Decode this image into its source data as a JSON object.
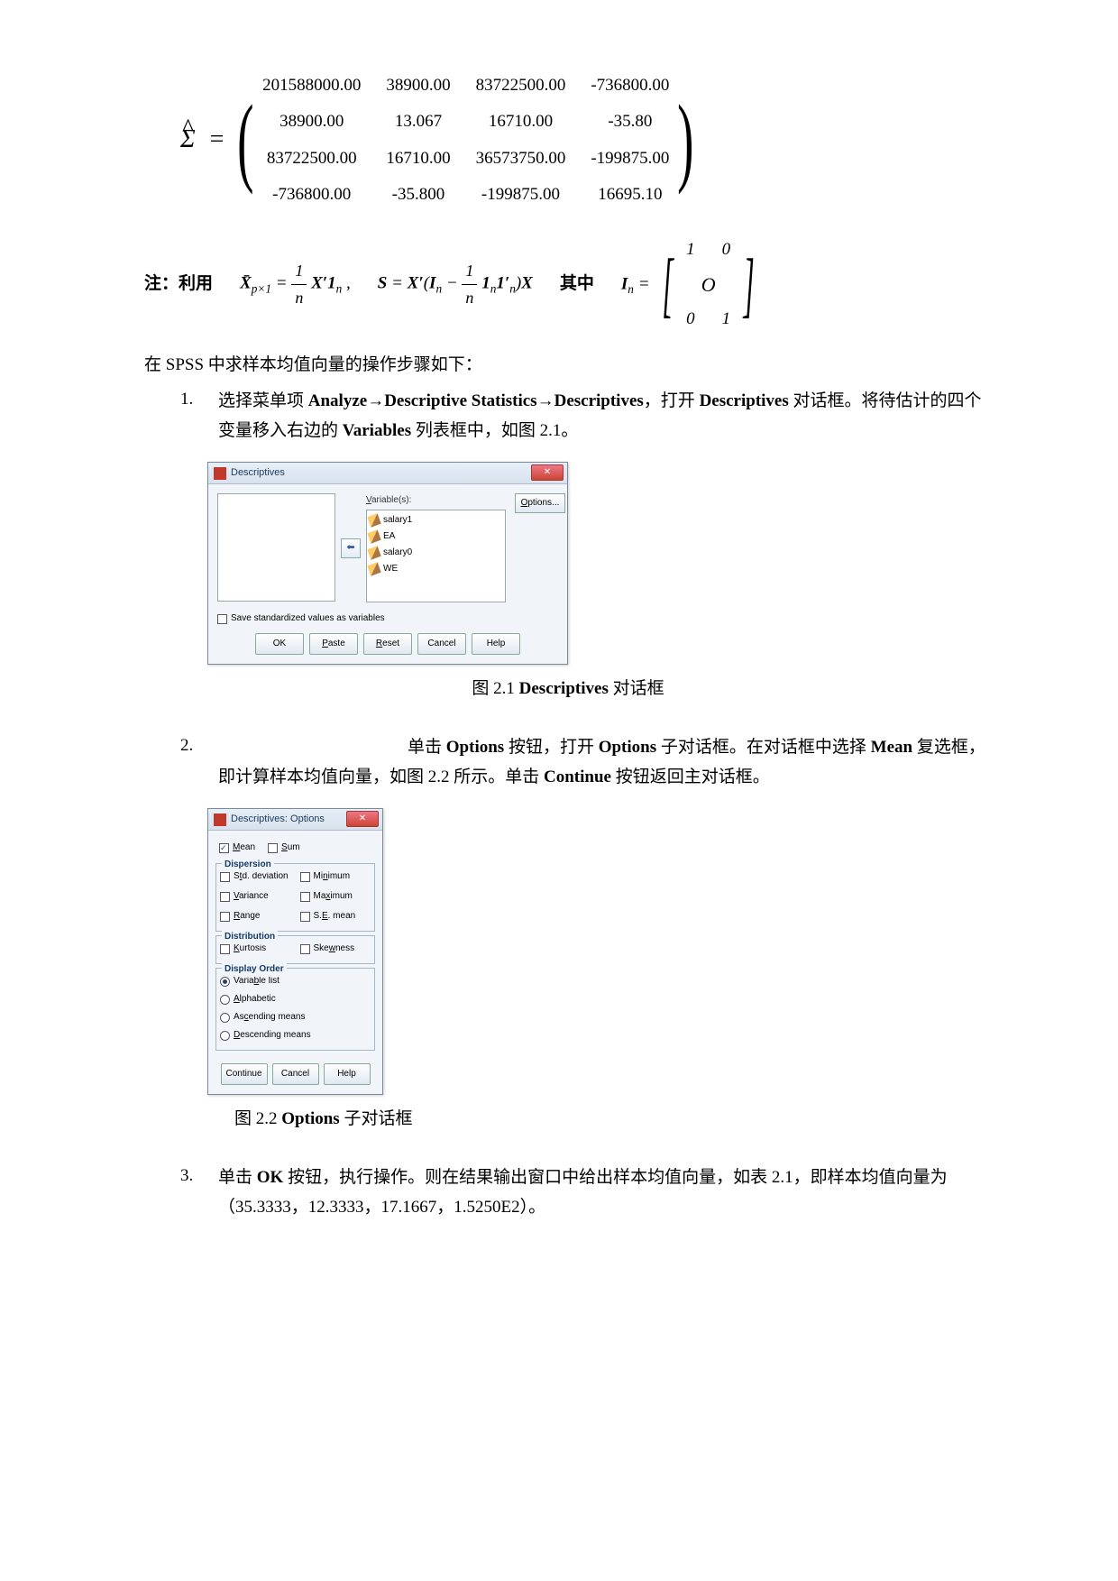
{
  "matrix": {
    "label": "Σ̂",
    "rows": [
      [
        "201588000.00",
        "38900.00",
        "83722500.00",
        "-736800.00"
      ],
      [
        "38900.00",
        "13.067",
        "16710.00",
        "-35.80"
      ],
      [
        "83722500.00",
        "16710.00",
        "36573750.00",
        "-199875.00"
      ],
      [
        "-736800.00",
        "-35.800",
        "-199875.00",
        "16695.10"
      ]
    ]
  },
  "formulas": {
    "note": "注：利用",
    "zhong": "其中"
  },
  "intro": "在 SPSS 中求样本均值向量的操作步骤如下：",
  "steps": {
    "s1": {
      "num": "1.",
      "t1": "选择菜单项 ",
      "a1": "Analyze",
      "arrow": "→",
      "a2": "Descriptive Statistics",
      "a3": "Descriptives",
      "t2": "，打开 ",
      "a4": "Descriptives",
      "t3": " 对话框。将待估计的四个变量移入右边的 ",
      "a5": "Variables",
      "t4": " 列表框中，如图 2.1。"
    },
    "s2": {
      "num": "2.",
      "t1": "单击 ",
      "a1": "Options",
      "t2": " 按钮，打开 ",
      "a2": "Options",
      "t3": " 子对话框。在对话框中选择 ",
      "a3": "Mean",
      "t4": " 复选框，即计算样本均值向量，如图 2.2 所示。单击 ",
      "a4": "Continue",
      "t5": " 按钮返回主对话框。"
    },
    "s3": {
      "num": "3.",
      "t1": "单击 ",
      "a1": "OK",
      "t2": " 按钮，执行操作。则在结果输出窗口中给出样本均值向量，如表 2.1，即样本均值向量为（35.3333，12.3333，17.1667，1.5250E2）。"
    }
  },
  "captions": {
    "c1_pre": "图 2.1   ",
    "c1_bold": "Descriptives",
    "c1_post": " 对话框",
    "c2_pre": "图 2.2 ",
    "c2_bold": "Options",
    "c2_post": " 子对话框"
  },
  "dialog1": {
    "title": "Descriptives",
    "close": "✕",
    "var_label": "Variable(s):",
    "vars": [
      "salary1",
      "EA",
      "salary0",
      "WE"
    ],
    "options_btn": "Options...",
    "arrow": "⬅",
    "save_chk": "Save standardized values as variables",
    "buttons": [
      "OK",
      "Paste",
      "Reset",
      "Cancel",
      "Help"
    ]
  },
  "dialog2": {
    "title": "Descriptives: Options",
    "close": "✕",
    "mean": "Mean",
    "sum": "Sum",
    "g_dispersion": "Dispersion",
    "std": "Std. deviation",
    "min": "Minimum",
    "var": "Variance",
    "max": "Maximum",
    "range": "Range",
    "se": "S.E. mean",
    "g_distribution": "Distribution",
    "kurt": "Kurtosis",
    "skew": "Skewness",
    "g_display": "Display Order",
    "varlist": "Variable list",
    "alpha": "Alphabetic",
    "asc": "Ascending means",
    "desc": "Descending means",
    "buttons": [
      "Continue",
      "Cancel",
      "Help"
    ]
  }
}
